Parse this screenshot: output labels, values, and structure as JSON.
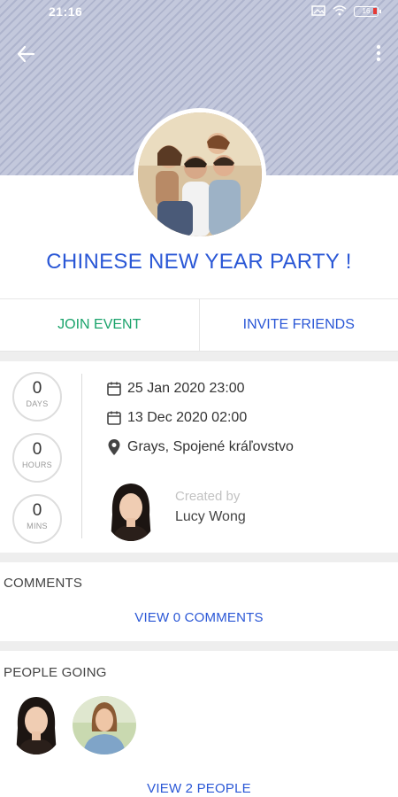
{
  "status_bar": {
    "time": "21:16",
    "battery": "16"
  },
  "event": {
    "title": "CHINESE NEW YEAR PARTY !"
  },
  "actions": {
    "join": "JOIN EVENT",
    "invite": "INVITE FRIENDS"
  },
  "countdown": [
    {
      "value": "0",
      "unit": "DAYS"
    },
    {
      "value": "0",
      "unit": "HOURS"
    },
    {
      "value": "0",
      "unit": "MINS"
    }
  ],
  "details": {
    "start": "25 Jan 2020 23:00",
    "end": "13 Dec 2020 02:00",
    "location": "Grays, Spojené kráľovstvo"
  },
  "creator": {
    "label": "Created by",
    "name": "Lucy Wong"
  },
  "comments": {
    "title": "COMMENTS",
    "link": "VIEW 0 COMMENTS"
  },
  "people": {
    "title": "PEOPLE GOING",
    "link": "VIEW 2 PEOPLE"
  },
  "colors": {
    "accent": "#2a57d6",
    "join": "#1aa36b",
    "header": "#c3c8dc"
  }
}
